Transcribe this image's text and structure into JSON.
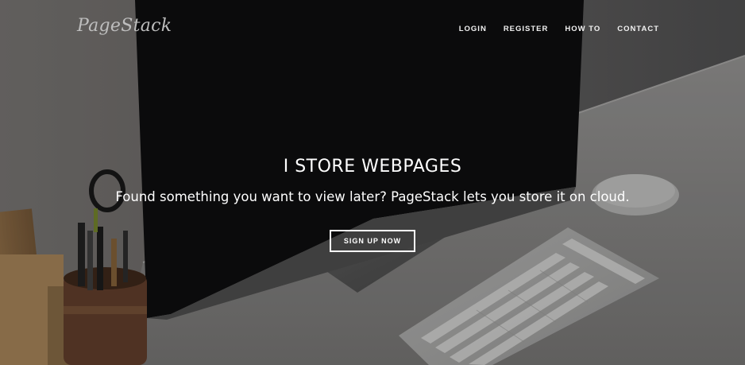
{
  "brand": {
    "name": "PageStack"
  },
  "nav": {
    "items": [
      {
        "label": "LOGIN"
      },
      {
        "label": "REGISTER"
      },
      {
        "label": "HOW TO"
      },
      {
        "label": "CONTACT"
      }
    ]
  },
  "hero": {
    "headline": "I STORE WEBPAGES",
    "subline": "Found something you want to view later? PageStack lets you store it on cloud.",
    "cta_label": "SIGN UP NOW"
  }
}
